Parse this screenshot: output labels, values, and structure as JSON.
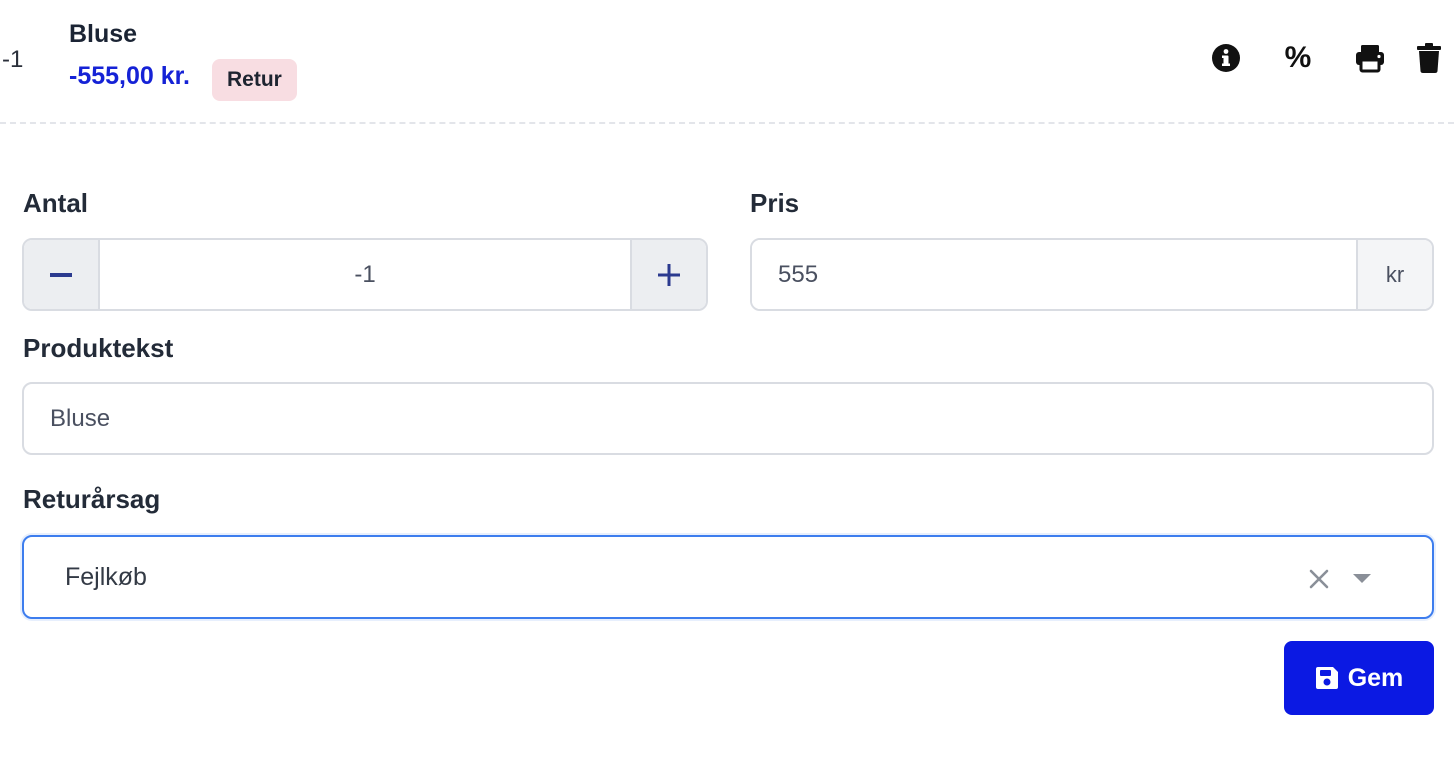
{
  "line_item": {
    "quantity_prefix": "-1",
    "name": "Bluse",
    "price": "-555,00 kr.",
    "badge": "Retur",
    "actions": {
      "info_icon": "info-circle-icon",
      "discount_label": "%",
      "print_icon": "printer-icon",
      "delete_icon": "trash-icon"
    }
  },
  "form": {
    "quantity": {
      "label": "Antal",
      "value": "-1",
      "decrement_icon": "minus-icon",
      "increment_icon": "plus-icon"
    },
    "price": {
      "label": "Pris",
      "value": "555",
      "unit": "kr"
    },
    "product_text": {
      "label": "Produktekst",
      "value": "Bluse"
    },
    "return_reason": {
      "label": "Returårsag",
      "selected": "Fejlkøb",
      "clear_icon": "close-icon",
      "caret_icon": "chevron-down-icon"
    },
    "save_button": {
      "label": "Gem",
      "icon": "floppy-disk-icon"
    }
  },
  "colors": {
    "accent": "#0b19e3",
    "price_text": "#1522d6",
    "badge_bg": "#f8dde2",
    "focus_border": "#3d7dee"
  }
}
